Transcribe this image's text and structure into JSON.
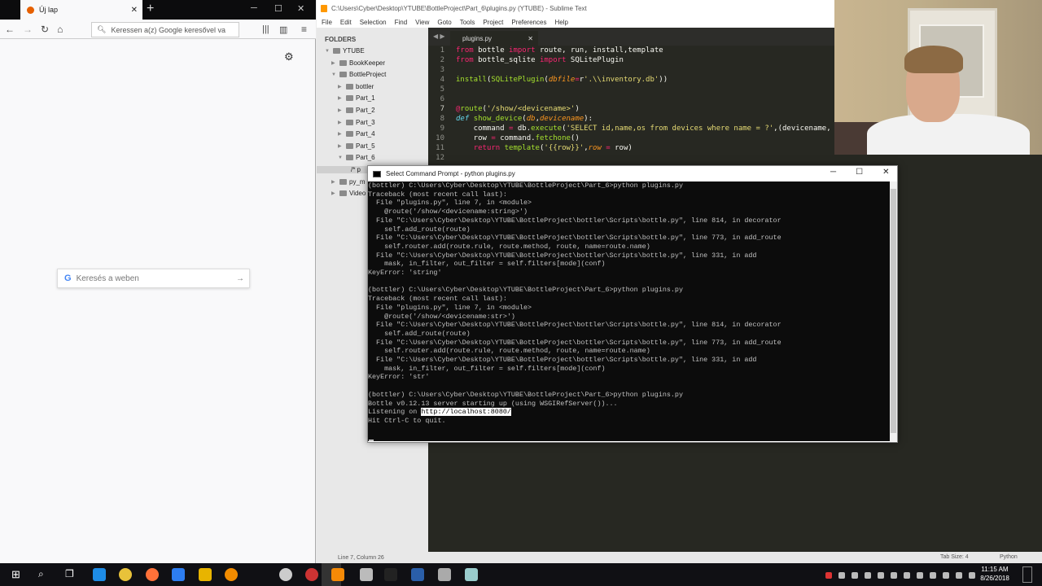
{
  "firefox": {
    "tab_title": "Új lap",
    "url_placeholder": "Keressen a(z) Google keresővel va",
    "search_placeholder": "Keresés a weben",
    "search_glyph": "G"
  },
  "sublime": {
    "title": "C:\\Users\\Cyber\\Desktop\\YTUBE\\BottleProject\\Part_6\\plugins.py (YTUBE) - Sublime Text",
    "menu": [
      "File",
      "Edit",
      "Selection",
      "Find",
      "View",
      "Goto",
      "Tools",
      "Project",
      "Preferences",
      "Help"
    ],
    "folders_header": "FOLDERS",
    "tree": [
      {
        "label": "YTUBE",
        "depth": 0,
        "open": true
      },
      {
        "label": "BookKeeper",
        "depth": 1,
        "open": false
      },
      {
        "label": "BottleProject",
        "depth": 1,
        "open": true
      },
      {
        "label": "bottler",
        "depth": 2,
        "open": false
      },
      {
        "label": "Part_1",
        "depth": 2,
        "open": false
      },
      {
        "label": "Part_2",
        "depth": 2,
        "open": false
      },
      {
        "label": "Part_3",
        "depth": 2,
        "open": false
      },
      {
        "label": "Part_4",
        "depth": 2,
        "open": false
      },
      {
        "label": "Part_5",
        "depth": 2,
        "open": false
      },
      {
        "label": "Part_6",
        "depth": 2,
        "open": true
      },
      {
        "label": "/*  p",
        "depth": 3,
        "open": false
      },
      {
        "label": "py_m",
        "depth": 1,
        "open": false
      },
      {
        "label": "Video",
        "depth": 1,
        "open": false
      }
    ],
    "tab_name": "plugins.py",
    "tab_arrows": "◀ ▶",
    "line_numbers": [
      "1",
      "2",
      "3",
      "4",
      "5",
      "6",
      "7",
      "8",
      "9",
      "10",
      "11",
      "12"
    ],
    "status_left": "Line 7, Column 26",
    "status_tab": "Tab Size: 4",
    "status_syntax": "Python"
  },
  "cmd": {
    "title": "Select Command Prompt - python  plugins.py",
    "lines": [
      "(bottler) C:\\Users\\Cyber\\Desktop\\YTUBE\\BottleProject\\Part_6>python plugins.py",
      "Traceback (most recent call last):",
      "  File \"plugins.py\", line 7, in <module>",
      "    @route('/show/<devicename:string>')",
      "  File \"C:\\Users\\Cyber\\Desktop\\YTUBE\\BottleProject\\bottler\\Scripts\\bottle.py\", line 814, in decorator",
      "    self.add_route(route)",
      "  File \"C:\\Users\\Cyber\\Desktop\\YTUBE\\BottleProject\\bottler\\Scripts\\bottle.py\", line 773, in add_route",
      "    self.router.add(route.rule, route.method, route, name=route.name)",
      "  File \"C:\\Users\\Cyber\\Desktop\\YTUBE\\BottleProject\\bottler\\Scripts\\bottle.py\", line 331, in add",
      "    mask, in_filter, out_filter = self.filters[mode](conf)",
      "KeyError: 'string'",
      "",
      "(bottler) C:\\Users\\Cyber\\Desktop\\YTUBE\\BottleProject\\Part_6>python plugins.py",
      "Traceback (most recent call last):",
      "  File \"plugins.py\", line 7, in <module>",
      "    @route('/show/<devicename:str>')",
      "  File \"C:\\Users\\Cyber\\Desktop\\YTUBE\\BottleProject\\bottler\\Scripts\\bottle.py\", line 814, in decorator",
      "    self.add_route(route)",
      "  File \"C:\\Users\\Cyber\\Desktop\\YTUBE\\BottleProject\\bottler\\Scripts\\bottle.py\", line 773, in add_route",
      "    self.router.add(route.rule, route.method, route, name=route.name)",
      "  File \"C:\\Users\\Cyber\\Desktop\\YTUBE\\BottleProject\\bottler\\Scripts\\bottle.py\", line 331, in add",
      "    mask, in_filter, out_filter = self.filters[mode](conf)",
      "KeyError: 'str'",
      "",
      "(bottler) C:\\Users\\Cyber\\Desktop\\YTUBE\\BottleProject\\Part_6>python plugins.py",
      "Bottle v0.12.13 server starting up (using WSGIRefServer())...",
      "Listening on ",
      "Hit Ctrl-C to quit."
    ],
    "selected_url": "http://localhost:8080/"
  },
  "taskbar": {
    "time": "11:15 AM",
    "date": "8/26/2018",
    "icons": [
      "windows-start",
      "search",
      "task-view",
      "edge",
      "chrome",
      "firefox",
      "store",
      "files",
      "vlc",
      "github",
      "obs",
      "sublime",
      "inkscape",
      "terminal",
      "powershell",
      "database",
      "virtual-machine"
    ]
  },
  "colors": {
    "editor_bg": "#272822",
    "keyword": "#f92672",
    "function": "#a6e22e",
    "string": "#e6db74",
    "param": "#fd971f",
    "cmd_bg": "#0c0c0c"
  }
}
